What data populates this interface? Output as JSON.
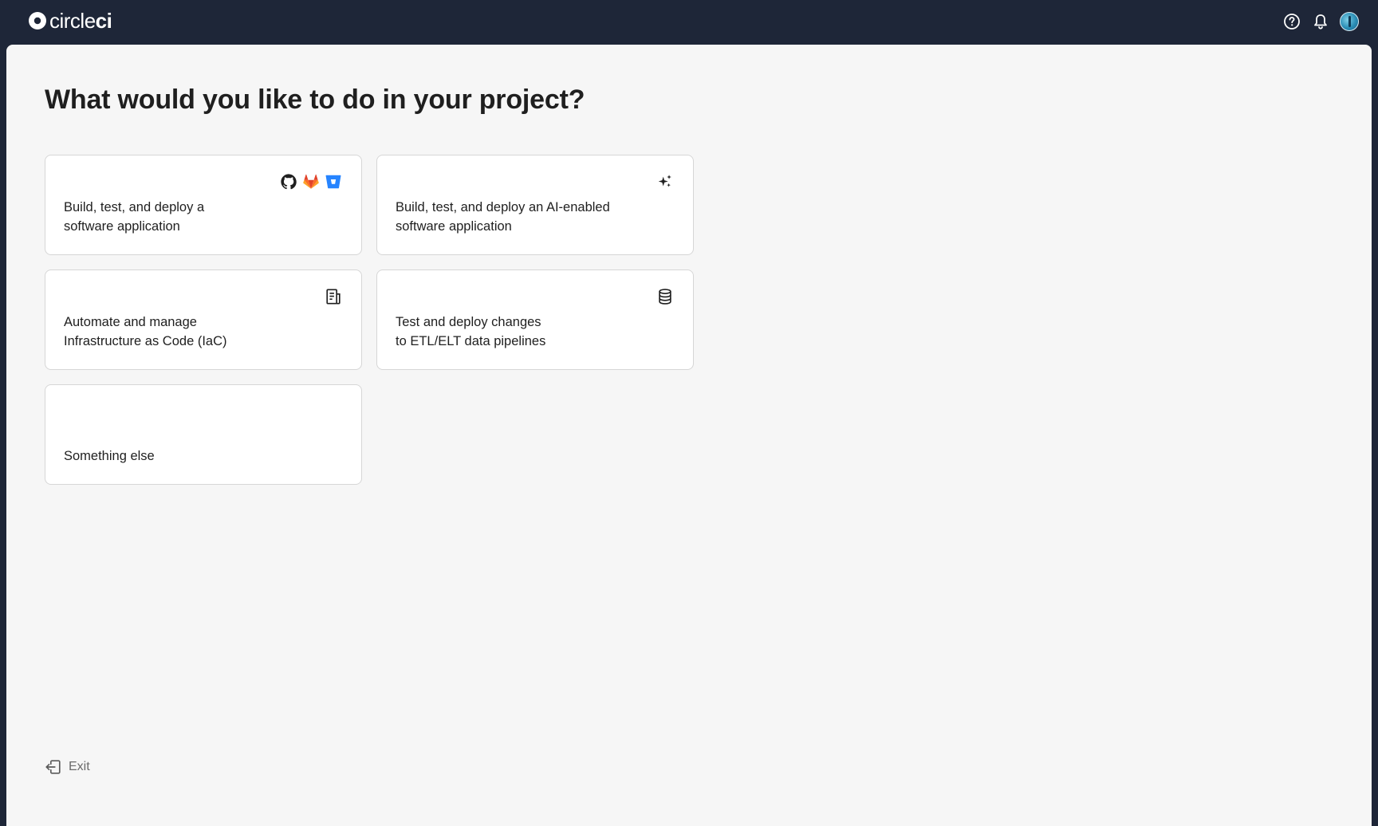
{
  "brand": {
    "name_light": "circle",
    "name_bold": "ci",
    "logo_icon": "circleci-logo-icon"
  },
  "topbar": {
    "icons": [
      "help-icon",
      "bell-icon",
      "avatar"
    ]
  },
  "page": {
    "title": "What would you like to do in your project?"
  },
  "cards": [
    {
      "line1": "Build, test, and deploy a",
      "line2": "software application",
      "icons": [
        "github-icon",
        "gitlab-icon",
        "bitbucket-icon"
      ]
    },
    {
      "line1": "Build, test, and deploy an AI-enabled",
      "line2": "software application",
      "icons": [
        "sparkles-icon"
      ]
    },
    {
      "line1": "Automate and manage",
      "line2": "Infrastructure as Code (IaC)",
      "icons": [
        "document-icon"
      ]
    },
    {
      "line1": "Test and deploy changes",
      "line2": "to ETL/ELT data pipelines",
      "icons": [
        "database-icon"
      ]
    },
    {
      "line1": "Something else",
      "line2": "",
      "icons": []
    }
  ],
  "footer": {
    "exit_label": "Exit",
    "exit_icon": "exit-icon"
  },
  "colors": {
    "topbar": "#1e2638",
    "panel": "#f6f6f6",
    "card_border": "#d6d6d6",
    "gitlab_orange": "#e2432a",
    "bitbucket_blue": "#2684ff"
  }
}
